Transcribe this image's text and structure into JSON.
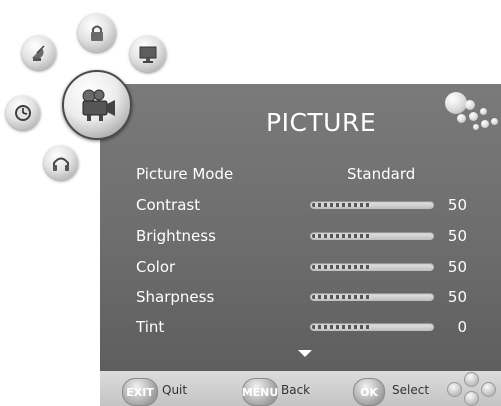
{
  "menu": {
    "title": "PICTURE",
    "items": [
      {
        "label": "Picture Mode",
        "value": "Standard"
      },
      {
        "label": "Contrast",
        "value": "50",
        "level": 0.5
      },
      {
        "label": "Brightness",
        "value": "50",
        "level": 0.5
      },
      {
        "label": "Color",
        "value": "50",
        "level": 0.5
      },
      {
        "label": "Sharpness",
        "value": "50",
        "level": 0.5
      },
      {
        "label": "Tint",
        "value": "0",
        "level": 0.5
      }
    ]
  },
  "footer": {
    "exit_key": "EXIT",
    "exit_label": "Quit",
    "menu_key": "MENU",
    "menu_label": "Back",
    "ok_key": "OK",
    "ok_label": "Select"
  },
  "categories": [
    {
      "name": "channel",
      "icon": "satellite-dish-icon"
    },
    {
      "name": "lock",
      "icon": "lock-icon"
    },
    {
      "name": "screen",
      "icon": "monitor-icon"
    },
    {
      "name": "picture",
      "icon": "camcorder-icon",
      "active": true
    },
    {
      "name": "time",
      "icon": "clock-icon"
    },
    {
      "name": "audio",
      "icon": "headphones-icon"
    }
  ]
}
